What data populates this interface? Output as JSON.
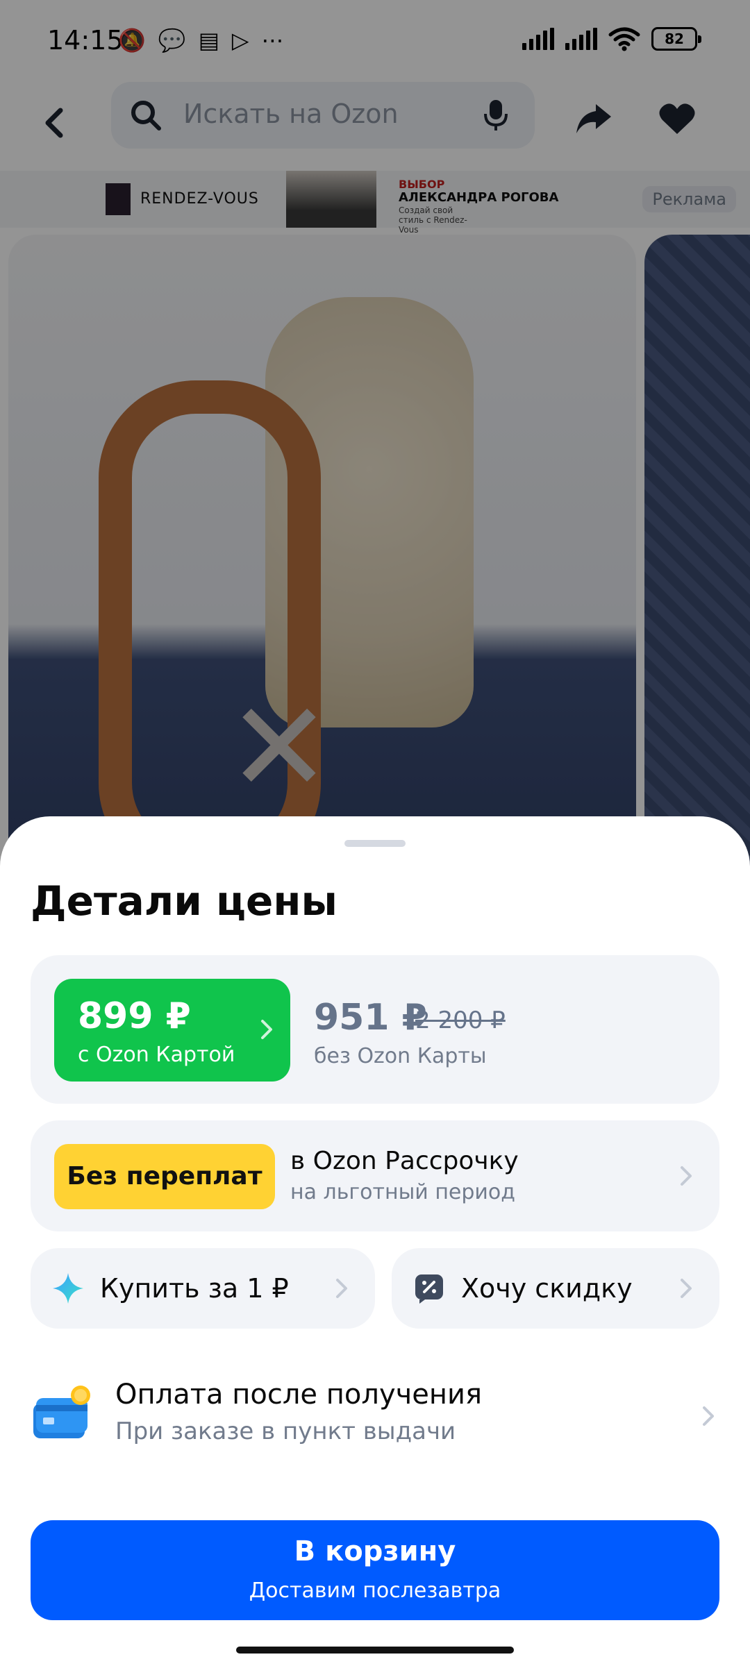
{
  "status_bar": {
    "time": "14:15",
    "battery": "82",
    "left_icons": [
      "mute-bell-icon",
      "chat-bubble-icon",
      "news-icon",
      "play-store-icon",
      "more-dots-icon"
    ],
    "left_glyphs": [
      "🔕",
      "💬",
      "▤",
      "▷",
      "⋯"
    ]
  },
  "header": {
    "search_placeholder": "Искать на Ozon"
  },
  "ad_banner": {
    "brand": "RENDEZ-VOUS",
    "line1": "ВЫБОР",
    "line2": "АЛЕКСАНДРА РОГОВА",
    "line3": "Создай свой стиль с Rendez-Vous",
    "label": "Реклама"
  },
  "sheet": {
    "title": "Детали цены",
    "card_price": {
      "value": "899 ₽",
      "label": "с Ozon Картой"
    },
    "regular_price": {
      "value": "951 ₽",
      "old_value": "2 200 ₽",
      "label": "без Ozon Карты"
    },
    "installment": {
      "badge": "Без переплат",
      "title": "в Ozon Рассрочку",
      "subtitle": "на льготный период"
    },
    "buy_for_1": {
      "label": "Купить за 1 ₽"
    },
    "want_discount": {
      "label": "Хочу скидку"
    },
    "pay_after": {
      "title": "Оплата после получения",
      "subtitle": "При заказе в пункт выдачи"
    },
    "cart_button": {
      "title": "В корзину",
      "subtitle": "Доставим послезавтра"
    }
  },
  "colors": {
    "card_price_green": "#10c44c",
    "installment_yellow": "#ffd233",
    "cart_blue": "#005bff",
    "card_background": "#f2f4f8",
    "muted_text": "#717b8c"
  }
}
